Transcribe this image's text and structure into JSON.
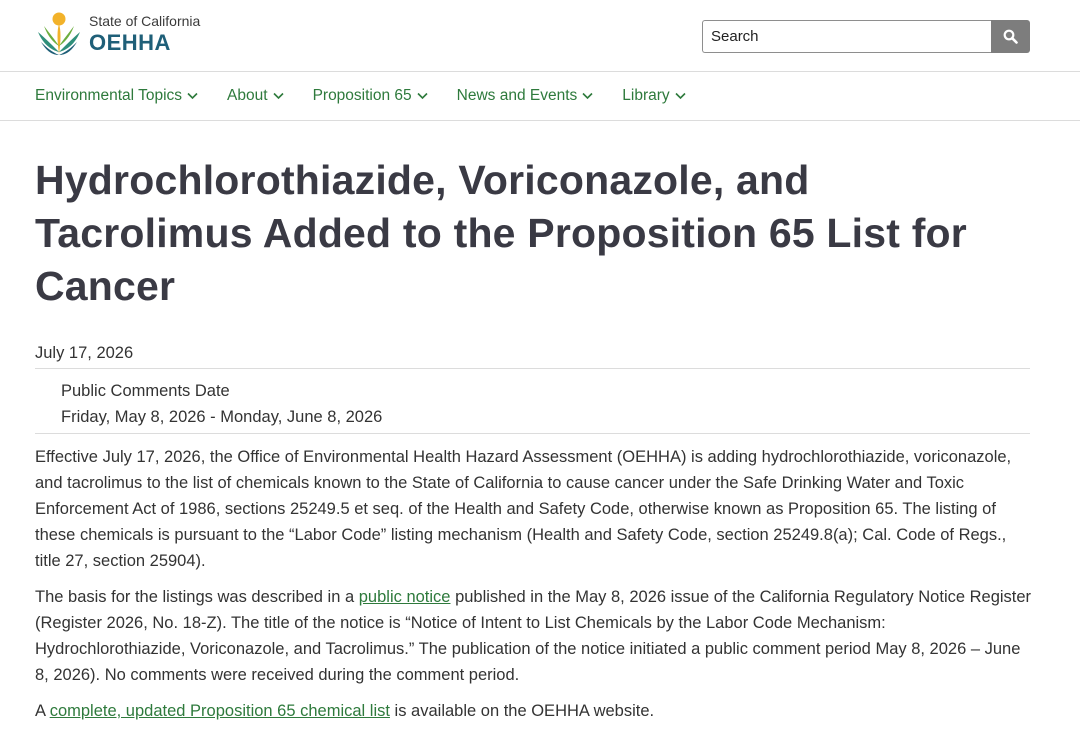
{
  "header": {
    "logo_state": "State of California",
    "logo_org": "OEHHA",
    "search_placeholder": "Search"
  },
  "nav": {
    "items": [
      {
        "label": "Environmental Topics"
      },
      {
        "label": "About"
      },
      {
        "label": "Proposition 65"
      },
      {
        "label": "News and Events"
      },
      {
        "label": "Library"
      }
    ]
  },
  "article": {
    "title": "Hydrochlorothiazide, Voriconazole, and Tacrolimus Added to the Proposition 65 List for Cancer",
    "date": "July 17, 2026",
    "comments_label": "Public Comments Date",
    "comments_range": "Friday, May 8, 2026 - Monday, June 8, 2026",
    "p1": "Effective July 17, 2026, the Office of Environmental Health Hazard Assessment (OEHHA) is adding hydrochlorothiazide, voriconazole, and tacrolimus to the list of chemicals known to the State of California to cause cancer under the Safe Drinking Water and Toxic Enforcement Act of 1986, sections 25249.5 et seq. of the Health and Safety Code, otherwise known as Proposition 65. The listing of these chemicals is pursuant to the “Labor Code” listing mechanism (Health and Safety Code, section 25249.8(a); Cal. Code of Regs., title 27, section 25904).",
    "p2_before": "The basis for the listings was described in a ",
    "p2_link": "public notice",
    "p2_after": " published in the May 8, 2026 issue of the California Regulatory Notice Register (Register 2026, No. 18-Z). The title of the notice is “Notice of Intent to List Chemicals by the Labor Code Mechanism: Hydrochlorothiazide, Voriconazole, and Tacrolimus.” The publication of the notice initiated a public comment period May 8, 2026 – June 8, 2026). No comments were received during the comment period.",
    "p3_before": "A ",
    "p3_link": "complete, updated Proposition 65 chemical list",
    "p3_after": " is available on the OEHHA website."
  },
  "colors": {
    "nav_link": "#2e7a3c",
    "title": "#3a3a44",
    "logo_blue": "#1f5f78",
    "search_button": "#7d7d7d"
  },
  "icons": {
    "logo": "oehha-logo-icon",
    "search": "search-icon",
    "dropdown": "chevron-down-icon"
  }
}
